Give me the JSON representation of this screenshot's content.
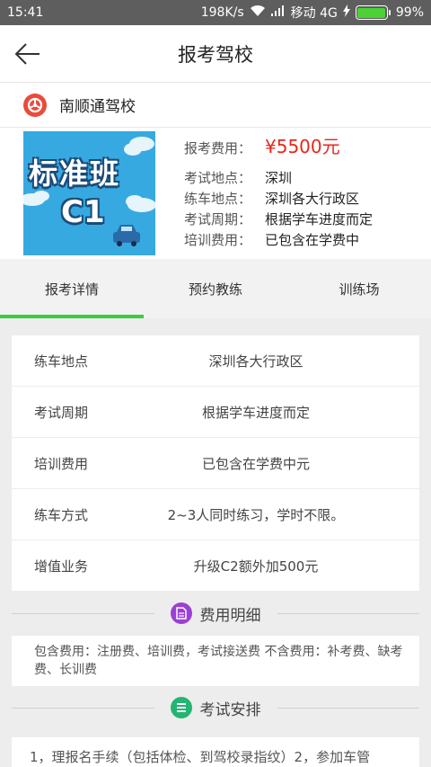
{
  "statusbar": {
    "time": "15:41",
    "speed": "198K/s",
    "carrier": "移动 4G",
    "battery": "99%",
    "battery_level": 0.99
  },
  "nav": {
    "title": "报考驾校"
  },
  "school": {
    "name": "南顺通驾校"
  },
  "cover": {
    "line1": "标准班",
    "line2": "C1"
  },
  "details": {
    "price_label": "报考费用：",
    "price": "¥5500元",
    "rows": [
      {
        "label": "考试地点：",
        "value": "深圳"
      },
      {
        "label": "练车地点：",
        "value": "深圳各大行政区"
      },
      {
        "label": "考试周期：",
        "value": "根据学车进度而定"
      },
      {
        "label": "培训费用：",
        "value": "已包含在学费中"
      }
    ]
  },
  "tabs": [
    {
      "label": "报考详情"
    },
    {
      "label": "预约教练"
    },
    {
      "label": "训练场"
    }
  ],
  "list": [
    {
      "key": "练车地点",
      "value": "深圳各大行政区"
    },
    {
      "key": "考试周期",
      "value": "根据学车进度而定"
    },
    {
      "key": "培训费用",
      "value": "已包含在学费中元"
    },
    {
      "key": "练车方式",
      "value": "2~3人同时练习，学时不限。"
    },
    {
      "key": "增值业务",
      "value": "升级C2额外加500元"
    }
  ],
  "fee_section": {
    "title": "费用明细",
    "text": "包含费用：注册费、培训费，考试接送费 不含费用：补考费、缺考费、长训费"
  },
  "exam_section": {
    "title": "考试安排",
    "text": "1，理报名手续（包括体检、到驾校录指纹）2，参加车管"
  },
  "colors": {
    "accent_green": "#3dcc3d",
    "price_red": "#e8261c",
    "fee_icon": "#9b3fd6",
    "exam_icon": "#22b573"
  }
}
